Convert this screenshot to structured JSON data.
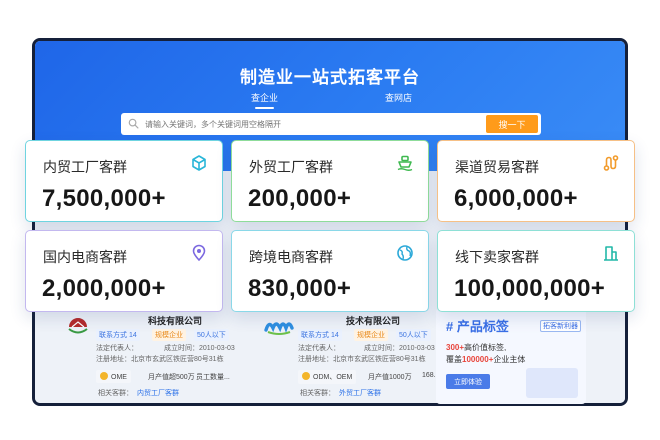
{
  "hero": {
    "title": "制造业一站式拓客平台",
    "tab_company": "查企业",
    "tab_shop": "查网店",
    "search_placeholder": "请输入关键词，多个关键词用空格隔开",
    "search_button": "搜一下"
  },
  "cards": [
    {
      "title": "内贸工厂客群",
      "value": "7,500,000+",
      "icon": "cube-icon",
      "color": "#29b6d8"
    },
    {
      "title": "外贸工厂客群",
      "value": "200,000+",
      "icon": "ship-icon",
      "color": "#3fb950"
    },
    {
      "title": "渠道贸易客群",
      "value": "6,000,000+",
      "icon": "route-icon",
      "color": "#f29b2b"
    },
    {
      "title": "国内电商客群",
      "value": "2,000,000+",
      "icon": "location-pin-icon",
      "color": "#7b68e0"
    },
    {
      "title": "跨境电商客群",
      "value": "830,000+",
      "icon": "globe-icon",
      "color": "#2aa8d8"
    },
    {
      "title": "线下卖家客群",
      "value": "100,000,000+",
      "icon": "storefront-icon",
      "color": "#22b8a8"
    }
  ],
  "companies": [
    {
      "name": "科技有限公司",
      "contact": "联系方式 14",
      "tag1": "规模企业",
      "tag2": "50人以下",
      "legal": "法定代表人：",
      "founded": "成立时间：2010-03-03",
      "address": "注册地址：北京市玄武区铁匠营80号31栋",
      "biz1": "OME",
      "biz2": "月产值超500万",
      "biz3": "员工数量...",
      "related_label": "相关客群：",
      "related_value": "内贸工厂客群"
    },
    {
      "name": "技术有限公司",
      "contact": "联系方式 14",
      "tag1": "规模企业",
      "tag2": "50人以下",
      "legal": "法定代表人：",
      "founded": "成立时间：2010-03-03",
      "address": "注册地址：北京市玄武区铁匠营80号31栋",
      "biz1": "ODM、OEM",
      "biz2": "月产值1000万",
      "biz3": "168...",
      "related_label": "相关客群：",
      "related_value": "外贸工厂客群"
    }
  ],
  "product_label": {
    "title": "# 产品标签",
    "badge": "拓客新利器",
    "line1_highlight": "300+",
    "line1_rest": "高价值标签,",
    "line2_prefix": "覆盖",
    "line2_highlight": "100000+",
    "line2_rest": "企业主体",
    "button": "立即体验"
  }
}
